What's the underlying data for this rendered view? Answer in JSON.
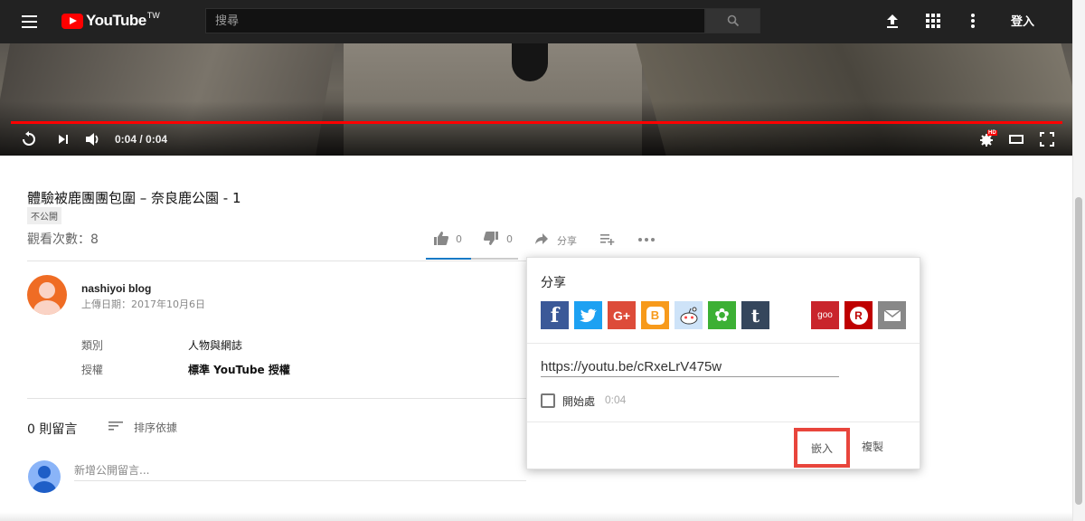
{
  "header": {
    "logo_text": "YouTube",
    "logo_sup": "TW",
    "search_placeholder": "搜尋",
    "signin_label": "登入"
  },
  "player": {
    "time": "0:04 / 0:04",
    "progress_fraction": 1.0,
    "hd_badge": "HD"
  },
  "video": {
    "title": "體驗被鹿團團包圍 – 奈良鹿公園 - 1",
    "privacy_badge": "不公開",
    "views": "觀看次數：8",
    "likes": "0",
    "dislikes": "0",
    "share_label": "分享"
  },
  "channel": {
    "name": "nashiyoi blog",
    "published": "上傳日期：2017年10月6日",
    "meta": [
      {
        "label": "類別",
        "value": "人物與網誌"
      },
      {
        "label": "授權",
        "value": "標準 YouTube 授權"
      }
    ]
  },
  "comments": {
    "count": "0 則留言",
    "sort_label": "排序依據",
    "placeholder": "新增公開留言..."
  },
  "share_panel": {
    "title": "分享",
    "services": [
      {
        "name": "facebook",
        "glyph": "f",
        "color": "#3b5998"
      },
      {
        "name": "twitter",
        "glyph": "t",
        "color": "#1da1f2"
      },
      {
        "name": "google-plus",
        "glyph": "G+",
        "color": "#dd4b39"
      },
      {
        "name": "blogger",
        "glyph": "B",
        "color": "#f79a1b"
      },
      {
        "name": "reddit",
        "glyph": "r",
        "color": "#cee3f8"
      },
      {
        "name": "line-share",
        "glyph": "✿",
        "color": "#3cb034"
      },
      {
        "name": "tumblr",
        "glyph": "t",
        "color": "#35465c"
      },
      {
        "name": "goo",
        "glyph": "goo",
        "color": "#c9252c"
      },
      {
        "name": "rakuten",
        "glyph": "R",
        "color": "#bf0000"
      },
      {
        "name": "email",
        "glyph": "✉",
        "color": "#888888"
      }
    ],
    "url": "https://youtu.be/cRxeLrV475w",
    "start_label": "開始處",
    "start_time": "0:04",
    "embed_label": "嵌入",
    "copy_label": "複製",
    "highlight_color": "#e8453c"
  }
}
